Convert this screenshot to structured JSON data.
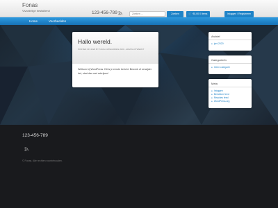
{
  "header": {
    "site_title": "Fonas",
    "tagline": "Vivardelige bestsillend",
    "phone": "123-456-789",
    "search_placeholder": "Zoeken ...",
    "search_button": "Zoeken",
    "cart_label": "€0,00 0 items",
    "login_label": "Inloggen / Registreren"
  },
  "nav": {
    "items": [
      "Home",
      "Voorbeelden"
    ]
  },
  "post": {
    "title": "Hallo wereld.",
    "meta": "Posted on 2020 by Tags-Categories 2020 - admin-uitwerkt",
    "body": "Welkom bij WordPress. Dit is je eerste bericht. Bewerk of verwijder het, start dan met schrijven!"
  },
  "sidebar": {
    "archive": {
      "title": "Archief",
      "items": [
        "juni 2020"
      ]
    },
    "categories": {
      "title": "Categorieën",
      "items": [
        "Geen categorie"
      ]
    },
    "meta": {
      "title": "Meta",
      "items": [
        "Inloggen",
        "Berichten feed",
        "Reacties feed",
        "WordPress.org"
      ]
    }
  },
  "footer": {
    "phone": "123-456-789",
    "copyright": "© Fonas. Alle rechten voorbehouden."
  },
  "colors": {
    "accent": "#1f83c7",
    "nav": "#1f83c7",
    "footer_bg": "#191a1d"
  },
  "icons": {
    "rss": "rss-icon",
    "cart": "cart-icon"
  }
}
